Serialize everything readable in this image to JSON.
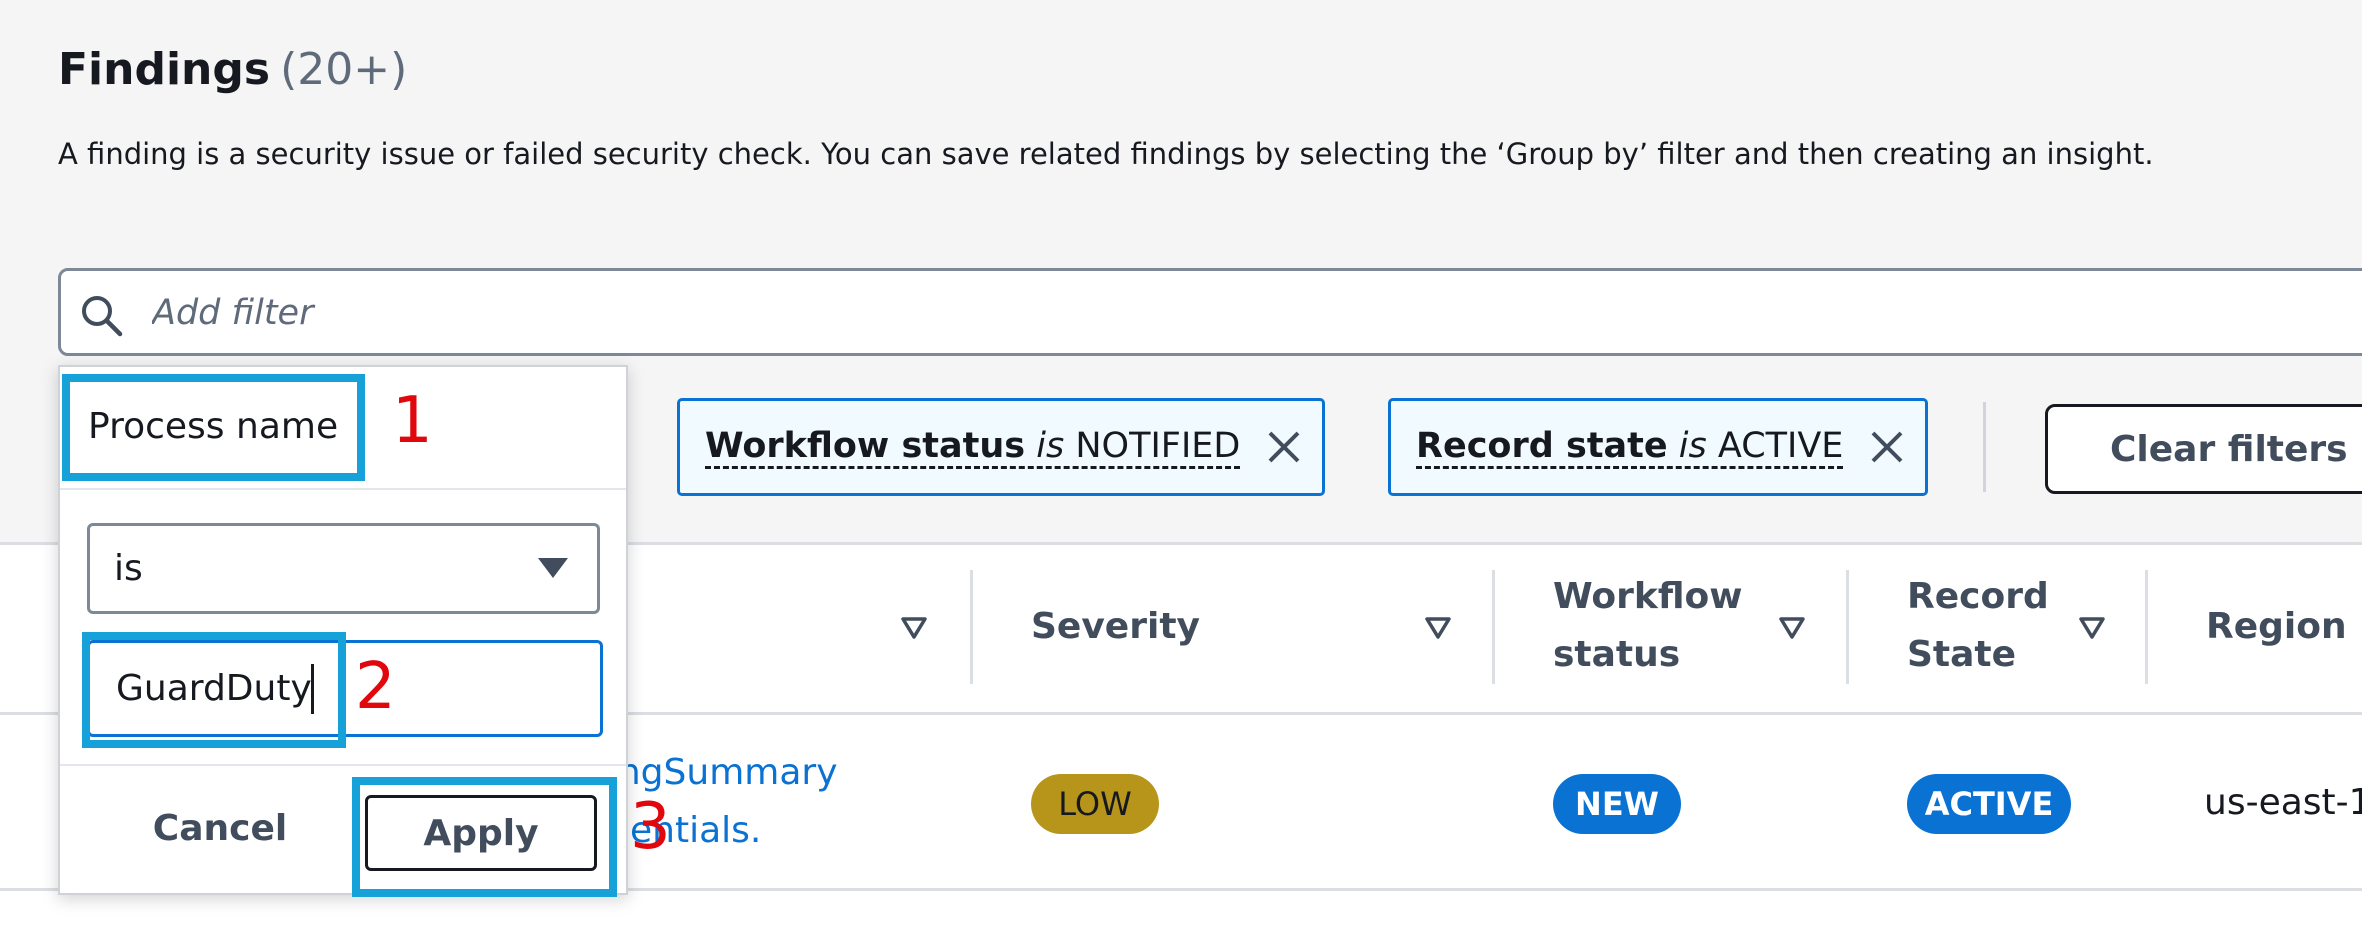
{
  "header": {
    "title": "Findings",
    "count": "(20+)",
    "description": "A finding is a security issue or failed security check. You can save related findings by selecting the ‘Group by’ filter and then creating an insight."
  },
  "filter": {
    "placeholder": "Add filter",
    "tokens": [
      {
        "property": "Workflow status",
        "operator": "is",
        "value": "NOTIFIED"
      },
      {
        "property": "Record state",
        "operator": "is",
        "value": "ACTIVE"
      }
    ],
    "clear_label": "Clear filters"
  },
  "popover": {
    "property_label": "Process name",
    "operator_value": "is",
    "value_input": "GuardDuty",
    "cancel_label": "Cancel",
    "apply_label": "Apply"
  },
  "table": {
    "columns": [
      {
        "line1": "Severity",
        "line2": ""
      },
      {
        "line1": "Workflow",
        "line2": "status"
      },
      {
        "line1": "Record",
        "line2": "State"
      },
      {
        "line1": "Region",
        "line2": ""
      }
    ],
    "row": {
      "title_line1": "dingSummary",
      "title_line2": "edentials.",
      "severity": "LOW",
      "workflow_status": "NEW",
      "record_state": "ACTIVE",
      "region": "us-east-1"
    }
  },
  "annotations": {
    "step1": "1",
    "step2": "2",
    "step3": "3"
  },
  "colors": {
    "link": "#0972d3",
    "severity_low": "#b7951b",
    "status_badge": "#0972d3",
    "annotation_box": "#16a1d9",
    "annotation_number": "#e0070d"
  }
}
